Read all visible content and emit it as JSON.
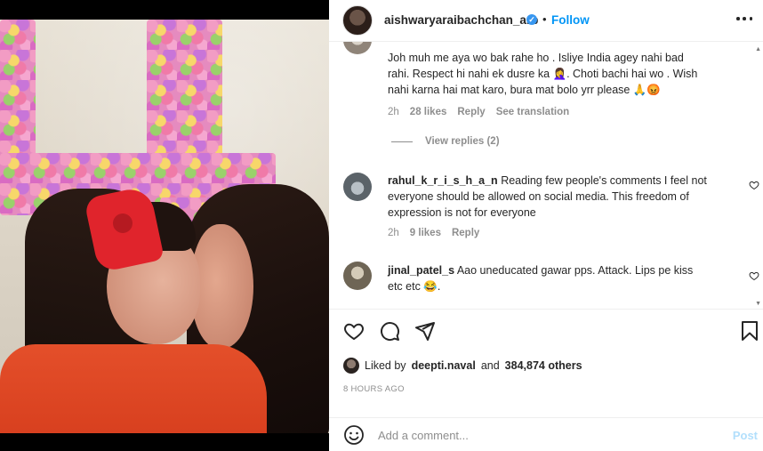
{
  "header": {
    "username": "aishwaryaraibachchan_arb",
    "verified_icon": "verified-badge-icon",
    "separator": "•",
    "follow_label": "Follow",
    "more_icon": "more-options-icon"
  },
  "comments": [
    {
      "id": "c1",
      "text": "Joh muh me aya wo bak rahe ho . Isliye India agey nahi bad rahi. Respect hi nahi ek dusre ka 🤦‍♀️. Choti bachi hai wo . Wish nahi karna hai mat karo, bura mat bolo yrr please 🙏😡",
      "line1": "Joh muh me aya wo bak rahe ho . Isliye India agey nahi bad",
      "line2": "rahi. Respect hi nahi ek dusre ka 🤦‍♀️. Choti bachi hai wo . Wish",
      "line3": "nahi karna hai mat karo, bura mat bolo yrr please 🙏😡",
      "time": "2h",
      "likes": "28 likes",
      "reply": "Reply",
      "translate": "See translation",
      "view_replies": "View replies (2)"
    },
    {
      "id": "c2",
      "username": "rahul_k_r_i_s_h_a_n",
      "line1": "Reading few people's comments I feel not",
      "line2": "everyone should be allowed on social media. This freedom of",
      "line3": "expression is not for everyone",
      "time": "2h",
      "likes": "9 likes",
      "reply": "Reply"
    },
    {
      "id": "c3",
      "username": "jinal_patel_s",
      "line1": "Aao uneducated gawar pps. Attack. Lips pe kiss",
      "line2": "etc etc 😂."
    }
  ],
  "likes": {
    "prefix": "Liked by",
    "user": "deepti.naval",
    "middle": "and",
    "count": "384,874 others"
  },
  "time_ago": "8 HOURS AGO",
  "add_comment": {
    "placeholder": "Add a comment...",
    "post_label": "Post"
  },
  "colors": {
    "accent": "#0095f6",
    "post_disabled": "#b2dffc",
    "muted": "#8e8e8e",
    "text": "#262626"
  },
  "icons": [
    "heart-icon",
    "comment-icon",
    "share-icon",
    "bookmark-icon",
    "emoji-icon"
  ]
}
